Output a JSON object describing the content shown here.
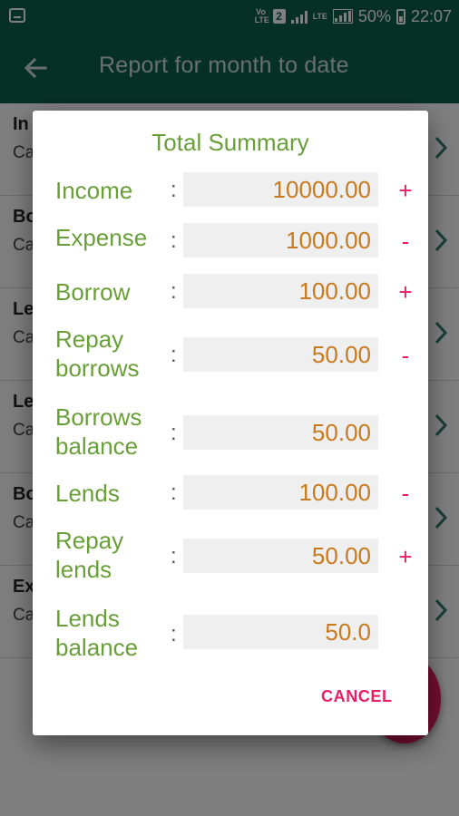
{
  "status_bar": {
    "volte": "Vo LTE",
    "sim_badge": "2",
    "lte_small": "LTE",
    "battery": "50%",
    "time": "22:07"
  },
  "app_bar": {
    "title": "Report for month to date"
  },
  "background_list": {
    "items": [
      {
        "title": "In",
        "subtitle": "Ca"
      },
      {
        "title": "Bo",
        "subtitle": "Ca"
      },
      {
        "title": "Le",
        "subtitle": "Ca"
      },
      {
        "title": "Le",
        "subtitle": "Ca"
      },
      {
        "title": "Bo",
        "subtitle": "Ca"
      },
      {
        "title": "Ex",
        "subtitle": "Ca"
      }
    ]
  },
  "dialog": {
    "title": "Total Summary",
    "colon": ":",
    "rows": [
      {
        "label": "Income",
        "value": "10000.00",
        "sign": "+"
      },
      {
        "label": "Expense",
        "value": "1000.00",
        "sign": "-"
      },
      {
        "label": "Borrow",
        "value": "100.00",
        "sign": "+"
      },
      {
        "label": "Repay borrows",
        "value": "50.00",
        "sign": "-"
      },
      {
        "label": "Borrows balance",
        "value": "50.00",
        "sign": ""
      },
      {
        "label": "Lends",
        "value": "100.00",
        "sign": "-"
      },
      {
        "label": "Repay lends",
        "value": "50.00",
        "sign": "+"
      },
      {
        "label": "Lends balance",
        "value": "50.0",
        "sign": ""
      }
    ],
    "cancel_label": "CANCEL"
  },
  "colors": {
    "app_bar": "#0d5f4d",
    "label_green": "#689f38",
    "value_orange": "#c87a1e",
    "accent_pink": "#e91e63"
  },
  "icons": [
    "notification-icon",
    "back-arrow-icon",
    "chevron-right-icon",
    "signal-icon",
    "battery-icon"
  ]
}
